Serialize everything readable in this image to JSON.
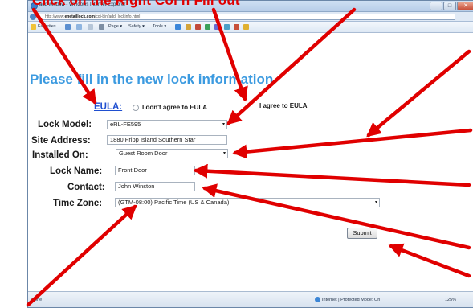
{
  "caption": "Click on the Right Col     n    Fill out",
  "window": {
    "title": "add window - Windows Internet Explorer",
    "url_prefix": "http://www.",
    "url_host": "enetaillock.com",
    "url_path": "/cgi-bin/add_lockinfo.html",
    "controls": [
      "–",
      "□",
      "✕"
    ]
  },
  "toolbar": {
    "items": [
      "Favorites",
      "Page ▾",
      "Safety ▾",
      "Tools ▾"
    ]
  },
  "page": {
    "title": "Please fill in the new lock information"
  },
  "form": {
    "eula_label": "EULA:",
    "eula_disagree": "I don't agree to EULA",
    "eula_agree": "I agree to EULA",
    "lock_model_label": "Lock Model:",
    "lock_model_value": "eRL-FE595",
    "site_address_label": "Site Address:",
    "site_address_value": "1880 Fripp Island Southern Star",
    "installed_on_label": "Installed On:",
    "installed_on_value": "Guest Room Door",
    "lock_name_label": "Lock Name:",
    "lock_name_value": "Front Door",
    "contact_label": "Contact:",
    "contact_value": "John Winston",
    "time_zone_label": "Time Zone:",
    "time_zone_value": "(GTM-08:00) Pacific Time (US & Canada)",
    "submit_label": "Submit"
  },
  "status": {
    "left": "Done",
    "zone": "Internet | Protected Mode: On",
    "zoom": "125%"
  },
  "colors": {
    "arrow": "#e00000",
    "title": "#3b9ae0",
    "link": "#1f4fd0"
  }
}
